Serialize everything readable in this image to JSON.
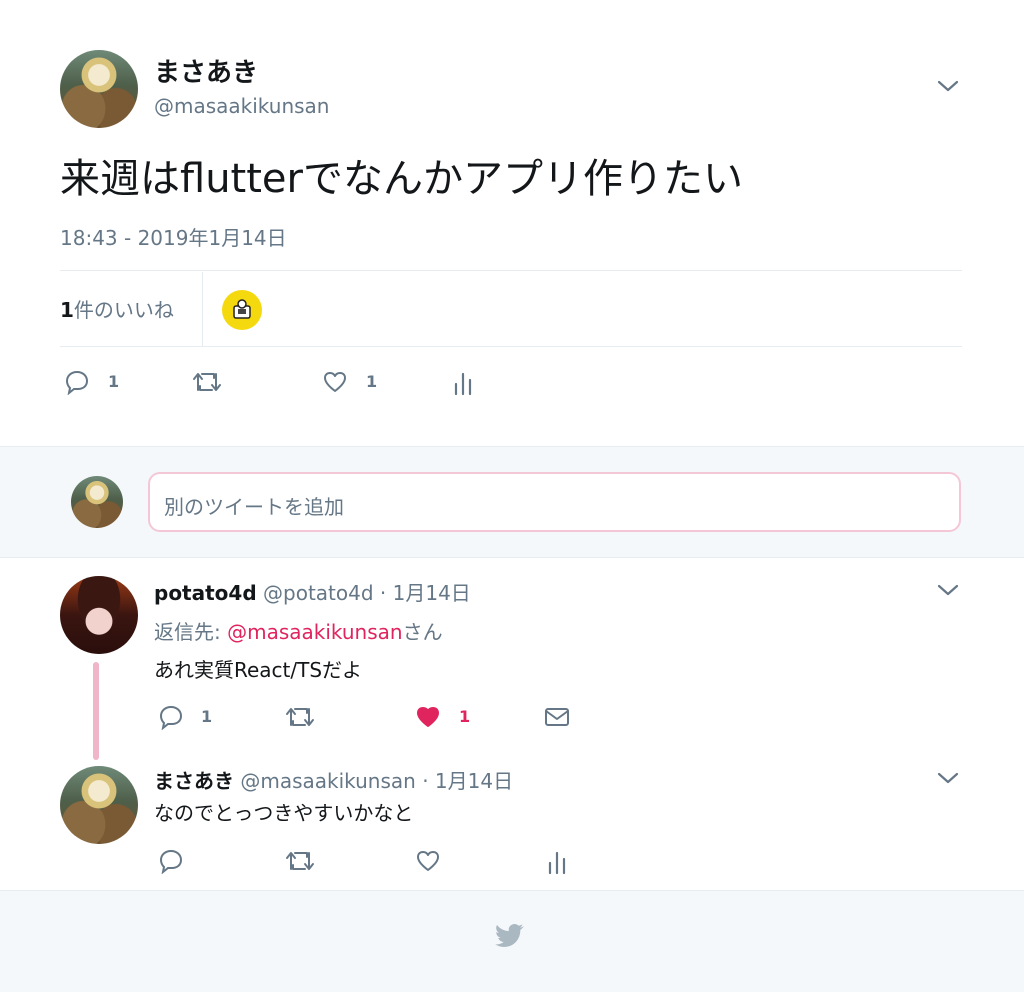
{
  "tweet": {
    "author_name": "まさあき",
    "author_handle": "@masaakikunsan",
    "text": "来週はflutterでなんかアプリ作りたい",
    "timestamp": "18:43 - 2019年1月14日",
    "likes_count_label": "1",
    "likes_suffix": "件のいいね",
    "reply_count": "1",
    "like_count": "1"
  },
  "reply_box": {
    "placeholder": "別のツイートを追加"
  },
  "replies": [
    {
      "name": "potato4d",
      "handle": "@potato4d",
      "date": "· 1月14日",
      "reply_to_prefix": "返信先: ",
      "reply_to_handle": "@masaakikunsan",
      "reply_to_suffix": "さん",
      "text": "あれ実質React/TSだよ",
      "reply_count": "1",
      "like_count": "1"
    },
    {
      "name": "まさあき",
      "handle": "@masaakikunsan",
      "date": "· 1月14日",
      "text": "なのでとっつきやすいかなと"
    }
  ],
  "colors": {
    "accent_pink": "#e0245e",
    "thread_line": "#f1b5c9",
    "muted": "#657786"
  },
  "icons": [
    "chevron-down-icon",
    "reply-icon",
    "retweet-icon",
    "heart-icon",
    "analytics-icon",
    "mail-icon",
    "twitter-bird-icon"
  ]
}
